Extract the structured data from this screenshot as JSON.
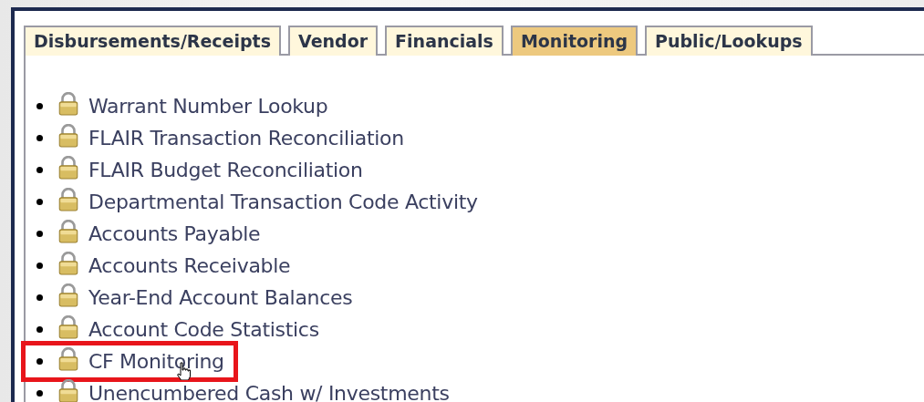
{
  "tabs": [
    {
      "label": "Disbursements/Receipts",
      "selected": false
    },
    {
      "label": "Vendor",
      "selected": false
    },
    {
      "label": "Financials",
      "selected": false
    },
    {
      "label": "Monitoring",
      "selected": true
    },
    {
      "label": "Public/Lookups",
      "selected": false
    }
  ],
  "links": [
    {
      "label": "Warrant Number Lookup",
      "highlighted": false
    },
    {
      "label": "FLAIR Transaction Reconciliation",
      "highlighted": false
    },
    {
      "label": "FLAIR Budget Reconciliation",
      "highlighted": false
    },
    {
      "label": "Departmental Transaction Code Activity",
      "highlighted": false
    },
    {
      "label": "Accounts Payable",
      "highlighted": false
    },
    {
      "label": "Accounts Receivable",
      "highlighted": false
    },
    {
      "label": "Year-End Account Balances",
      "highlighted": false
    },
    {
      "label": "Account Code Statistics",
      "highlighted": false
    },
    {
      "label": "CF Monitoring",
      "highlighted": true
    },
    {
      "label": "Unencumbered Cash w/ Investments",
      "highlighted": false
    }
  ]
}
